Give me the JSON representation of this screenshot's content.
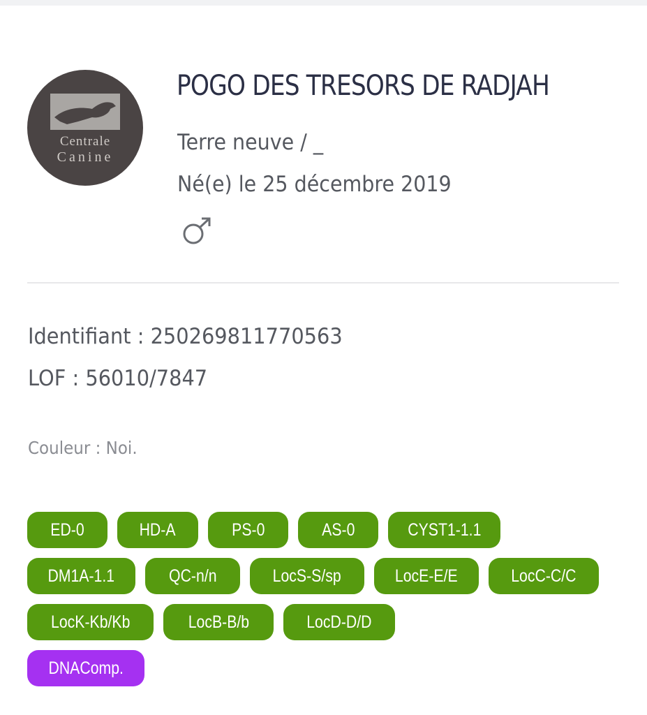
{
  "logo": {
    "line1": "Centrale",
    "line2": "Canine"
  },
  "dog": {
    "name": "POGO DES TRESORS DE RADJAH",
    "breed": "Terre neuve / _",
    "birth": "Né(e) le 25 décembre 2019",
    "sex_icon": "male-symbol-icon",
    "identifiant": "Identifiant : 250269811770563",
    "lof": "LOF : 56010/7847",
    "couleur": "Couleur : Noi."
  },
  "colors": {
    "green_badge": "#569a0f",
    "purple_badge": "#a531f1",
    "title": "#2b2f45",
    "text": "#55585f"
  },
  "badges": {
    "row1": [
      "ED-0",
      "HD-A",
      "PS-0",
      "AS-0",
      "CYST1-1.1"
    ],
    "row2": [
      "DM1A-1.1",
      "QC-n/n",
      "LocS-S/sp",
      "LocE-E/E",
      "LocC-C/C"
    ],
    "row3": [
      "LocK-Kb/Kb",
      "LocB-B/b",
      "LocD-D/D"
    ],
    "row4": [
      "DNAComp."
    ]
  }
}
